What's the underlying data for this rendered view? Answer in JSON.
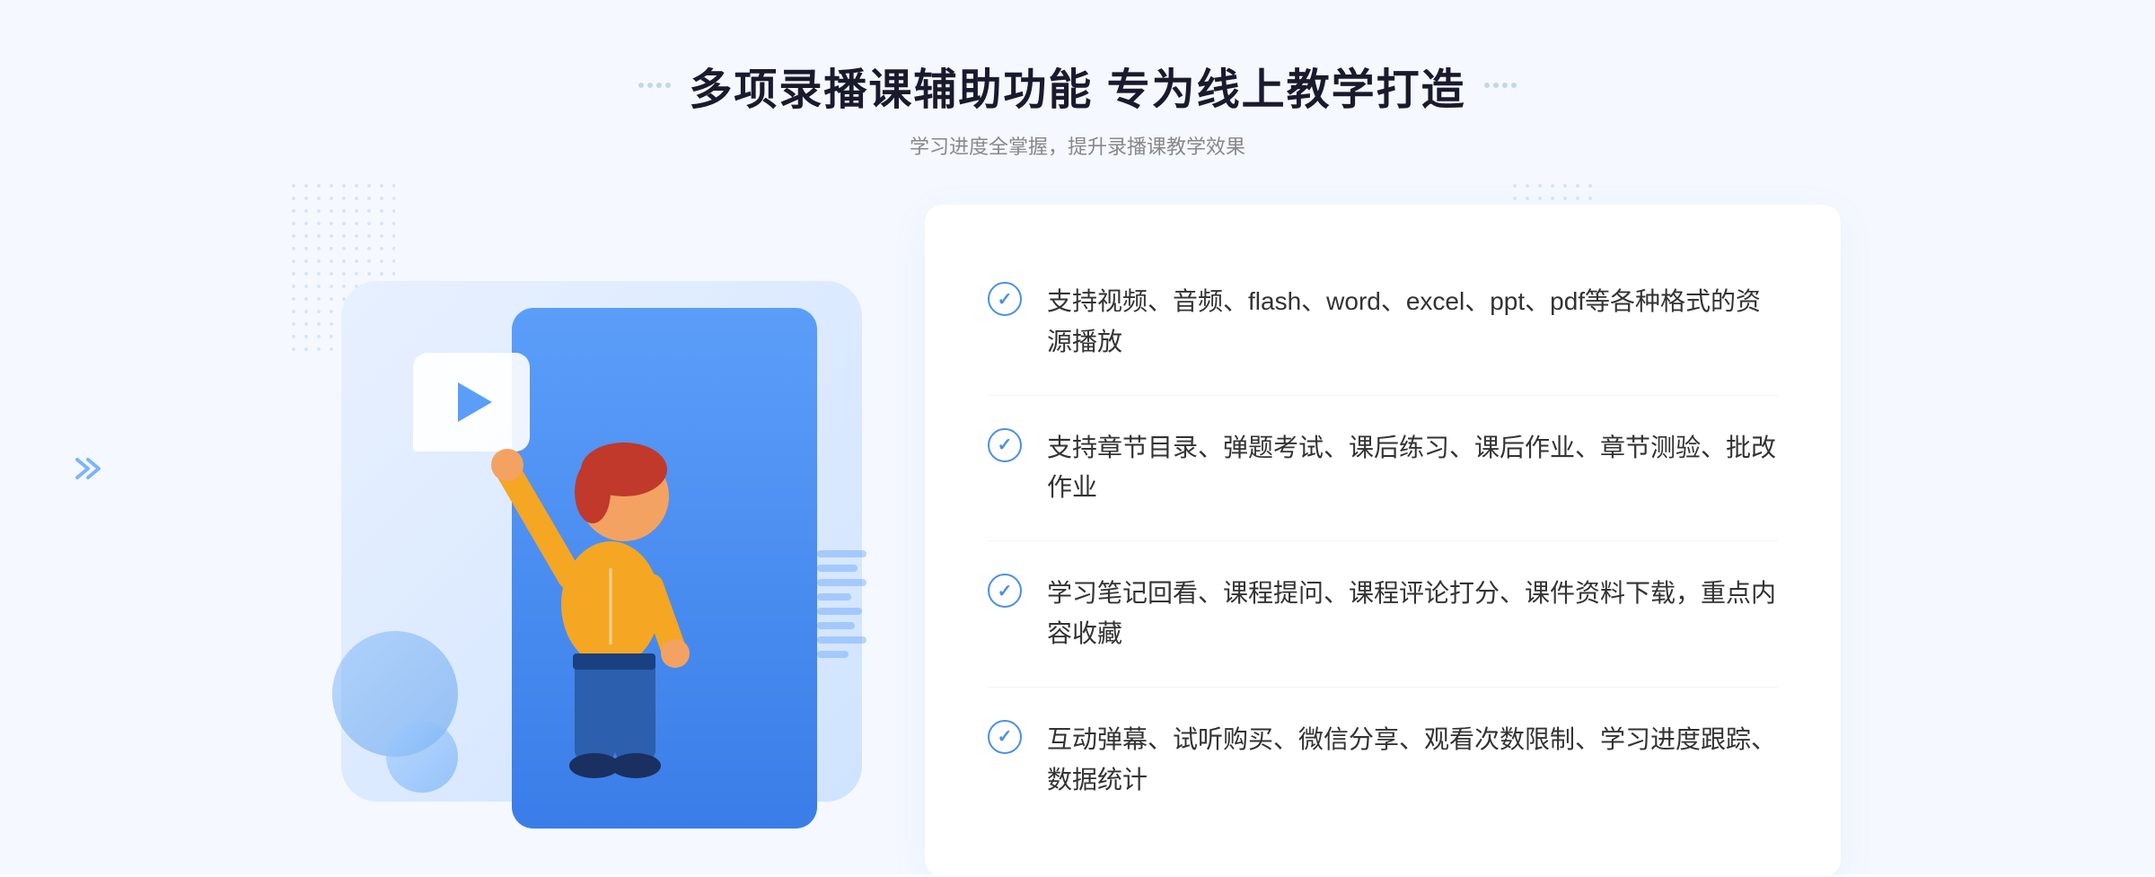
{
  "header": {
    "title": "多项录播课辅助功能 专为线上教学打造",
    "subtitle": "学习进度全掌握，提升录播课教学效果",
    "dots_left": [
      "•",
      "•"
    ],
    "dots_right": [
      "•",
      "•"
    ]
  },
  "features": [
    {
      "id": 1,
      "text": "支持视频、音频、flash、word、excel、ppt、pdf等各种格式的资源播放"
    },
    {
      "id": 2,
      "text": "支持章节目录、弹题考试、课后练习、课后作业、章节测验、批改作业"
    },
    {
      "id": 3,
      "text": "学习笔记回看、课程提问、课程评论打分、课件资料下载，重点内容收藏"
    },
    {
      "id": 4,
      "text": "互动弹幕、试听购买、微信分享、观看次数限制、学习进度跟踪、数据统计"
    }
  ],
  "icons": {
    "check": "✓",
    "play": "▶",
    "chevron": "»"
  },
  "colors": {
    "primary": "#4a90e2",
    "blue_gradient_start": "#5b9ef9",
    "blue_gradient_end": "#3a7de8",
    "text_dark": "#1a1a2e",
    "text_gray": "#888888",
    "text_body": "#333333",
    "bg_light": "#f5f8ff"
  }
}
